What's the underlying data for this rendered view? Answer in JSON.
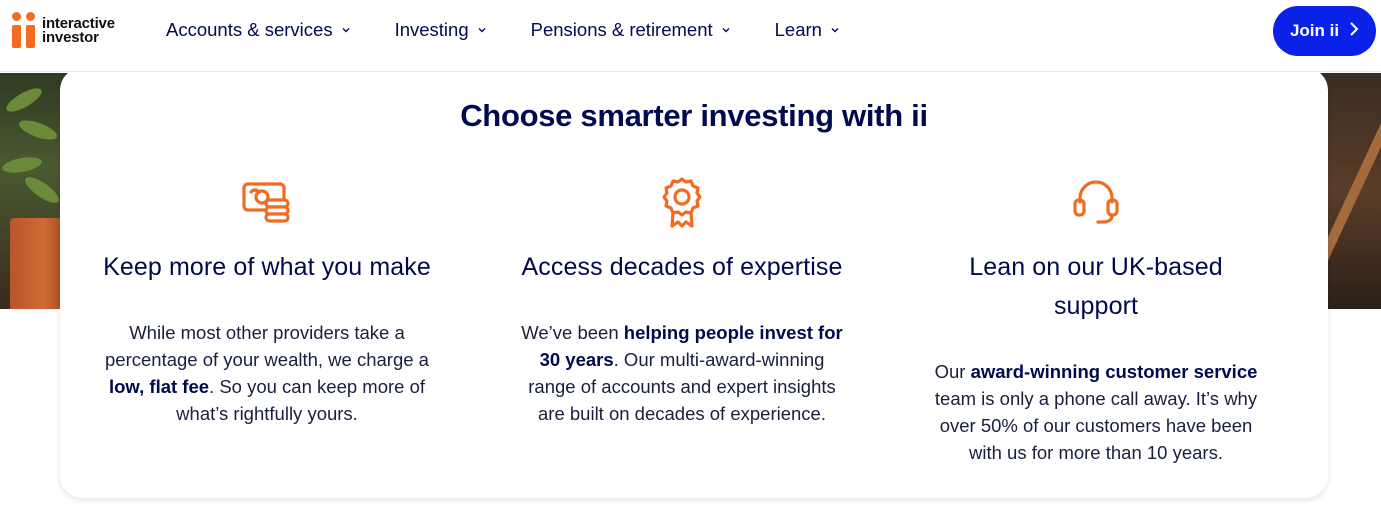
{
  "brand": {
    "line1": "interactive",
    "line2": "investor",
    "accent": "#f26b21",
    "primary": "#000a4f",
    "button_blue": "#0a22e8"
  },
  "nav": [
    {
      "label": "Accounts & services",
      "icon": "chevron-down-icon"
    },
    {
      "label": "Investing",
      "icon": "chevron-down-icon"
    },
    {
      "label": "Pensions & retirement",
      "icon": "chevron-down-icon"
    },
    {
      "label": "Learn",
      "icon": "chevron-down-icon"
    }
  ],
  "join": {
    "label": "Join ii",
    "icon": "chevron-right-icon"
  },
  "card": {
    "title": "Choose smarter investing with ii",
    "features": [
      {
        "icon": "money-coins-icon",
        "heading": "Keep more of what you make",
        "text": [
          "While most other providers take a percentage of your wealth, we charge a ",
          "low, flat fee",
          ". So you can keep more of what’s rightfully yours."
        ]
      },
      {
        "icon": "award-rosette-icon",
        "heading": "Access decades of expertise",
        "text": [
          "We’ve been ",
          "helping people invest for 30 years",
          ". Our multi-award-winning range of accounts and expert insights are built on decades of experience."
        ]
      },
      {
        "icon": "headset-icon",
        "heading": "Lean on our UK-based support",
        "text": [
          "Our ",
          "award-winning customer service",
          " team is only a phone call away. It’s why over 50% of our customers have been with us for more than 10 years."
        ]
      }
    ]
  }
}
